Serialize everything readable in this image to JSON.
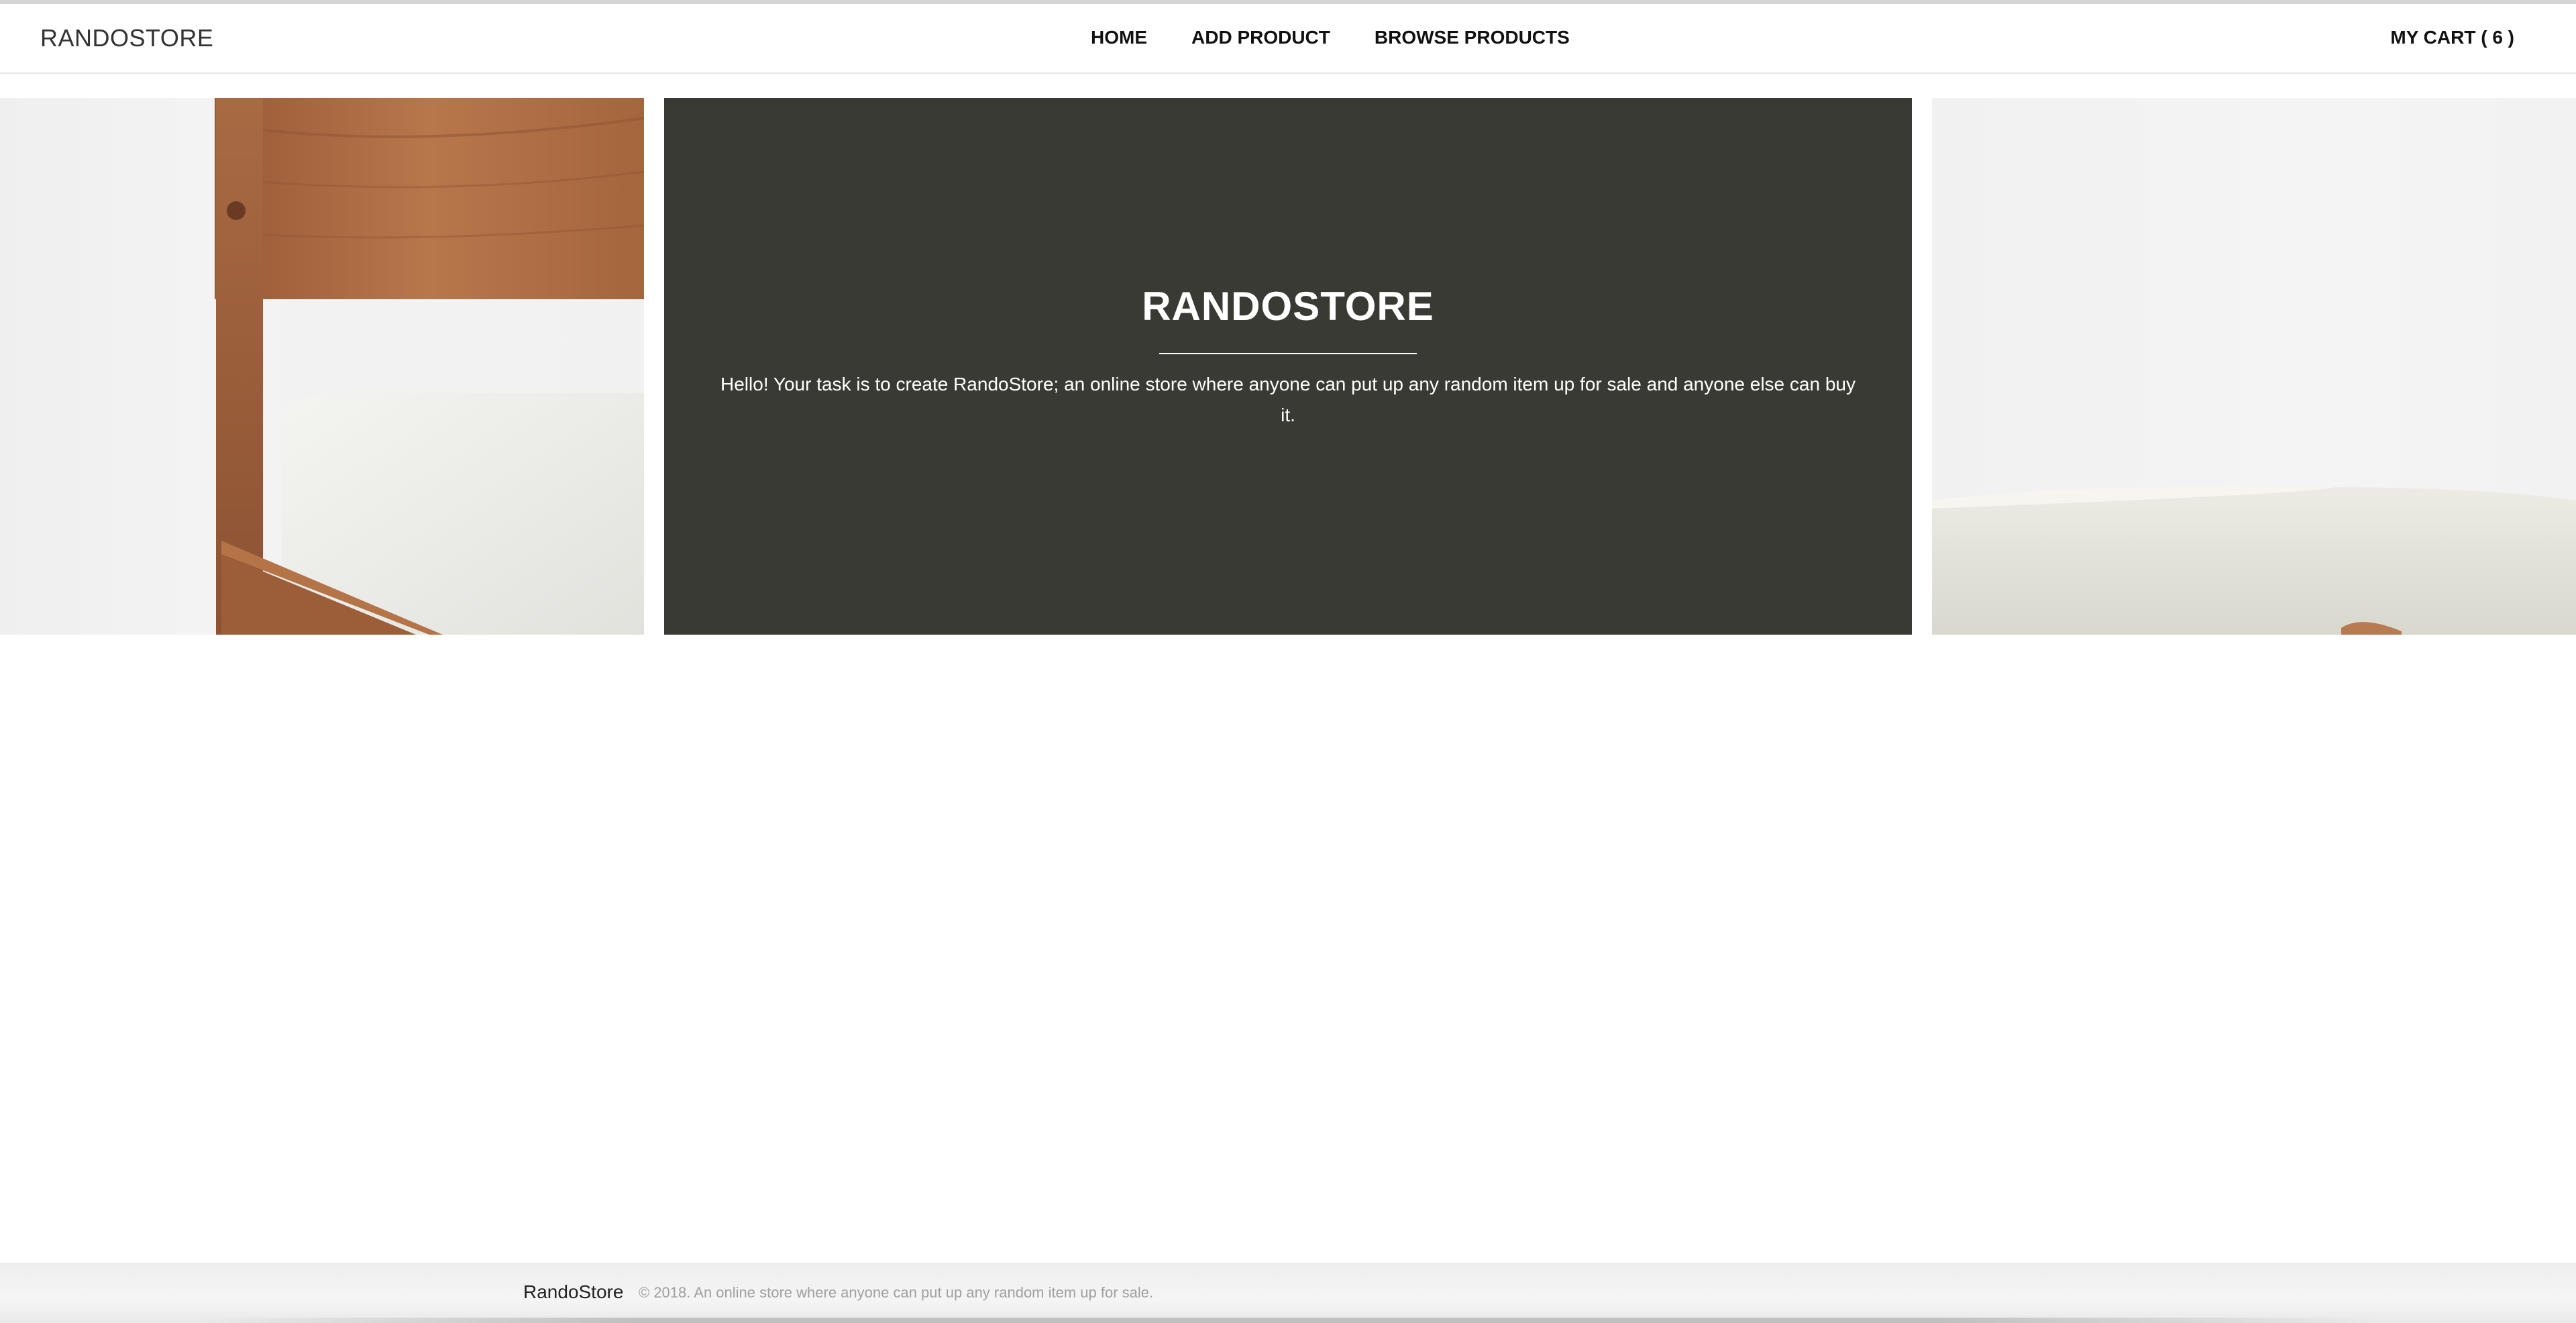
{
  "header": {
    "brand": "RANDOSTORE",
    "nav": [
      {
        "label": "HOME"
      },
      {
        "label": "ADD PRODUCT"
      },
      {
        "label": "BROWSE PRODUCTS"
      }
    ],
    "cart_label": "MY CART ( 6 )"
  },
  "hero": {
    "title": "RANDOSTORE",
    "text": "Hello! Your task is to create RandoStore; an online store where anyone can put up any random item up for sale and anyone else can buy it.",
    "left_image": "bed-frame-image",
    "right_image": "mattress-image",
    "colors": {
      "panel": "#3a3a34",
      "text": "#ffffff"
    }
  },
  "footer": {
    "brand": "RandoStore",
    "copyright": "© 2018. An online store where anyone can put up any random item up for sale."
  }
}
